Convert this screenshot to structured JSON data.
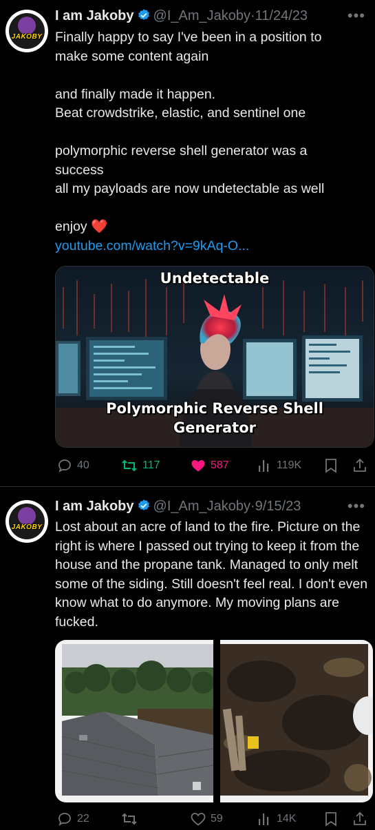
{
  "tweets": [
    {
      "author": {
        "name": "I am Jakoby",
        "handle": "@I_Am_Jakoby",
        "avatar_label": "JAKOBY"
      },
      "date": "11/24/23",
      "text_lines": [
        "Finally happy to say I've been in a position to make some content again",
        "",
        "and finally made it happen.\nBeat crowdstrike, elastic, and sentinel one",
        "",
        "polymorphic reverse shell generator was a success\nall my payloads are now undetectable as well",
        "",
        "enjoy ❤️"
      ],
      "link": "youtube.com/watch?v=9kAq-O...",
      "card": {
        "top_text": "Undetectable",
        "bottom_text": "Polymorphic Reverse Shell Generator"
      },
      "stats": {
        "replies": "40",
        "reposts": "117",
        "likes": "587",
        "views": "119K"
      }
    },
    {
      "author": {
        "name": "I am Jakoby",
        "handle": "@I_Am_Jakoby",
        "avatar_label": "JAKOBY"
      },
      "date": "9/15/23",
      "text": "Lost about an acre of land to the fire. Picture on the right is where I passed out trying to keep it from the house and the propane tank. Managed to only melt some of the siding. Still doesn't feel real. I don't even know what to do anymore. My moving plans are fucked.",
      "stats": {
        "replies": "22",
        "reposts": "",
        "likes": "59",
        "views": "14K"
      }
    }
  ],
  "colors": {
    "link": "#1d9bf0",
    "like_active": "#f91880",
    "repost_active": "#00ba7c",
    "muted": "#71767b",
    "verified": "#1d9bf0"
  }
}
